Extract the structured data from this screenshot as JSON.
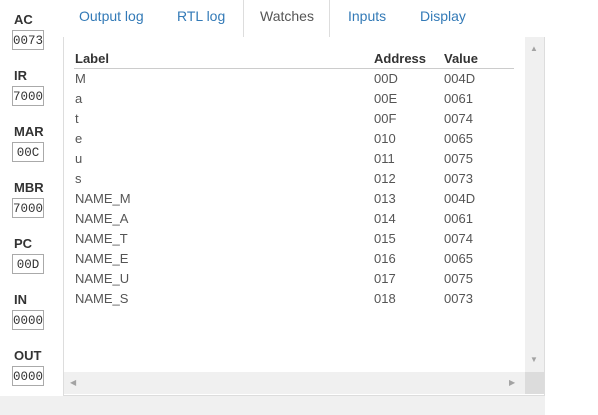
{
  "registers": [
    {
      "name": "AC",
      "value": "0073"
    },
    {
      "name": "IR",
      "value": "7000"
    },
    {
      "name": "MAR",
      "value": "00C"
    },
    {
      "name": "MBR",
      "value": "7000"
    },
    {
      "name": "PC",
      "value": "00D"
    },
    {
      "name": "IN",
      "value": "0000"
    },
    {
      "name": "OUT",
      "value": "0000"
    }
  ],
  "tabs": [
    {
      "label": "Output log"
    },
    {
      "label": "RTL log"
    },
    {
      "label": "Watches"
    },
    {
      "label": "Inputs"
    },
    {
      "label": "Display"
    }
  ],
  "active_tab": "Watches",
  "watches": {
    "columns": {
      "label": "Label",
      "address": "Address",
      "value": "Value"
    },
    "rows": [
      {
        "label": "M",
        "address": "00D",
        "value": "004D"
      },
      {
        "label": "a",
        "address": "00E",
        "value": "0061"
      },
      {
        "label": "t",
        "address": "00F",
        "value": "0074"
      },
      {
        "label": "e",
        "address": "010",
        "value": "0065"
      },
      {
        "label": "u",
        "address": "011",
        "value": "0075"
      },
      {
        "label": "s",
        "address": "012",
        "value": "0073"
      },
      {
        "label": "NAME_M",
        "address": "013",
        "value": "004D"
      },
      {
        "label": "NAME_A",
        "address": "014",
        "value": "0061"
      },
      {
        "label": "NAME_T",
        "address": "015",
        "value": "0074"
      },
      {
        "label": "NAME_E",
        "address": "016",
        "value": "0065"
      },
      {
        "label": "NAME_U",
        "address": "017",
        "value": "0075"
      },
      {
        "label": "NAME_S",
        "address": "018",
        "value": "0073"
      }
    ]
  },
  "scroll_arrows": {
    "up": "▲",
    "down": "▼",
    "left": "◀",
    "right": "▶"
  }
}
